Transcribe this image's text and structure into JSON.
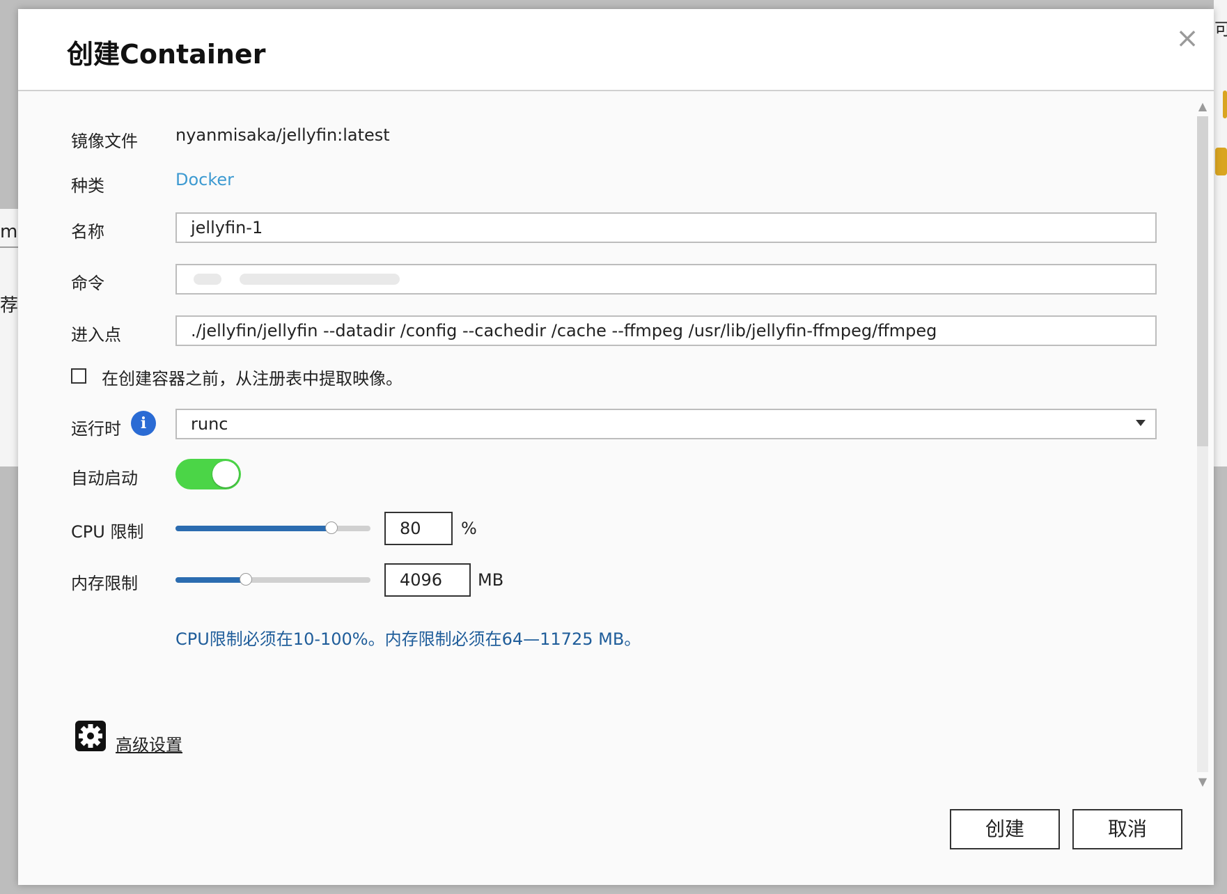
{
  "background": {
    "fragment_left_1": "mi",
    "fragment_left_2": "荐",
    "fragment_right_1": "可"
  },
  "dialog": {
    "title": "创建Container",
    "close_glyph": "×",
    "fields": {
      "image_label": "镜像文件",
      "image_value": "nyanmisaka/jellyfin:latest",
      "type_label": "种类",
      "type_value": "Docker",
      "name_label": "名称",
      "name_value": "jellyfin-1",
      "command_label": "命令",
      "command_value": "",
      "entrypoint_label": "进入点",
      "entrypoint_value": "./jellyfin/jellyfin --datadir /config --cachedir /cache --ffmpeg /usr/lib/jellyfin-ffmpeg/ffmpeg"
    },
    "pull_checkbox": {
      "label": "在创建容器之前，从注册表中提取映像。",
      "checked": false
    },
    "runtime": {
      "label": "运行时",
      "info_glyph": "i",
      "selected": "runc"
    },
    "autostart": {
      "label": "自动启动",
      "on": true
    },
    "cpu_limit": {
      "label": "CPU 限制",
      "value": "80",
      "unit": "%",
      "slider_fraction": 0.8
    },
    "memory_limit": {
      "label": "内存限制",
      "value": "4096",
      "unit": "MB",
      "slider_fraction": 0.36
    },
    "hint": "CPU限制必须在10-100%。内存限制必须在64—11725 MB。",
    "advanced_settings": "高级设置",
    "buttons": {
      "create": "创建",
      "cancel": "取消"
    },
    "colors": {
      "accent_blue": "#2b6cb0",
      "toggle_green": "#4bd547",
      "link_blue": "#3d9ad1",
      "hint_blue": "#1f5d9a"
    }
  }
}
